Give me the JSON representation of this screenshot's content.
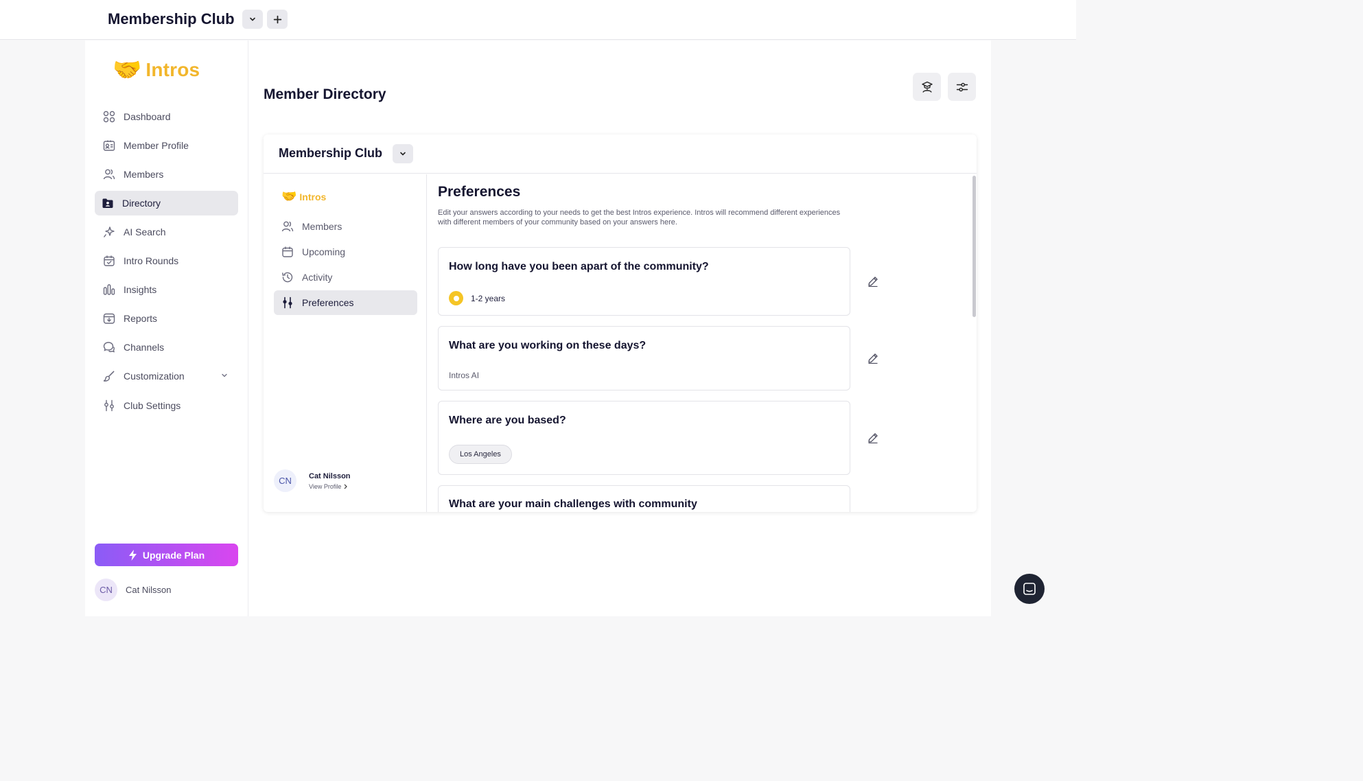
{
  "topbar": {
    "title": "Membership Club"
  },
  "sidebar": {
    "logo_text": "Intros",
    "items": [
      {
        "label": "Dashboard",
        "icon": "grid-icon"
      },
      {
        "label": "Member Profile",
        "icon": "id-card-icon"
      },
      {
        "label": "Members",
        "icon": "users-icon"
      },
      {
        "label": "Directory",
        "icon": "folder-user-icon",
        "active": true
      },
      {
        "label": "AI Search",
        "icon": "sparkle-icon"
      },
      {
        "label": "Intro Rounds",
        "icon": "calendar-check-icon"
      },
      {
        "label": "Insights",
        "icon": "bar-chart-icon"
      },
      {
        "label": "Reports",
        "icon": "inbox-download-icon"
      },
      {
        "label": "Channels",
        "icon": "chat-bubbles-icon"
      },
      {
        "label": "Customization",
        "icon": "brush-icon"
      },
      {
        "label": "Club Settings",
        "icon": "sliders-icon"
      }
    ],
    "upgrade_label": "Upgrade Plan",
    "user": {
      "initials": "CN",
      "name": "Cat Nilsson"
    }
  },
  "main": {
    "title": "Member Directory",
    "card": {
      "title": "Membership Club",
      "inner_logo_text": "Intros",
      "nav": [
        {
          "label": "Members",
          "icon": "users-icon"
        },
        {
          "label": "Upcoming",
          "icon": "calendar-icon"
        },
        {
          "label": "Activity",
          "icon": "history-icon"
        },
        {
          "label": "Preferences",
          "icon": "sliders-icon",
          "active": true
        }
      ],
      "user": {
        "initials": "CN",
        "name": "Cat Nilsson",
        "link": "View Profile"
      }
    },
    "preferences": {
      "title": "Preferences",
      "description": "Edit your answers according to your needs to get the best Intros experience. Intros will recommend different experiences with different members of your community based on your answers here.",
      "questions": [
        {
          "question": "How long have you been apart of the community?",
          "answer": "1-2 years"
        },
        {
          "question": "What are you working on these days?",
          "answer": "Intros AI"
        },
        {
          "question": "Where are you based?",
          "answer": "Los Angeles"
        },
        {
          "question": "What are your main challenges with community"
        }
      ]
    }
  },
  "colors": {
    "accent_yellow": "#f5c526",
    "brand_orange": "#f2b62c",
    "upgrade_gradient_start": "#8b5cf6",
    "upgrade_gradient_end": "#d946ef"
  }
}
